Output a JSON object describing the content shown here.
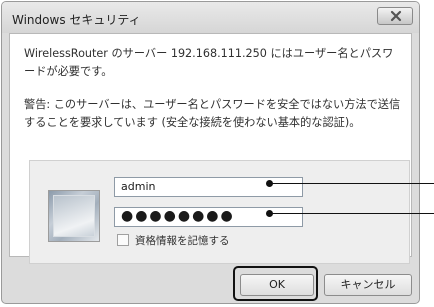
{
  "dialog": {
    "title": "Windows セキュリティ",
    "message": "WirelessRouter のサーバー 192.168.111.250 にはユーザー名とパスワードが必要です。",
    "warning": "警告: このサーバーは、ユーザー名とパスワードを安全ではない方法で送信することを要求しています (安全な接続を使わない基本的な認証)。",
    "username_value": "admin",
    "password_mask": "●●●●●●●●",
    "remember_label": "資格情報を記憶する",
    "ok_label": "OK",
    "cancel_label": "キャンセル",
    "remember_checked": false
  },
  "colors": {
    "dialog_bg": "#dcdcdc",
    "content_bg": "#ffffff",
    "panel_bg": "#eeeeee"
  },
  "icons": {
    "close": "close-icon",
    "user": "user-tile-icon"
  }
}
